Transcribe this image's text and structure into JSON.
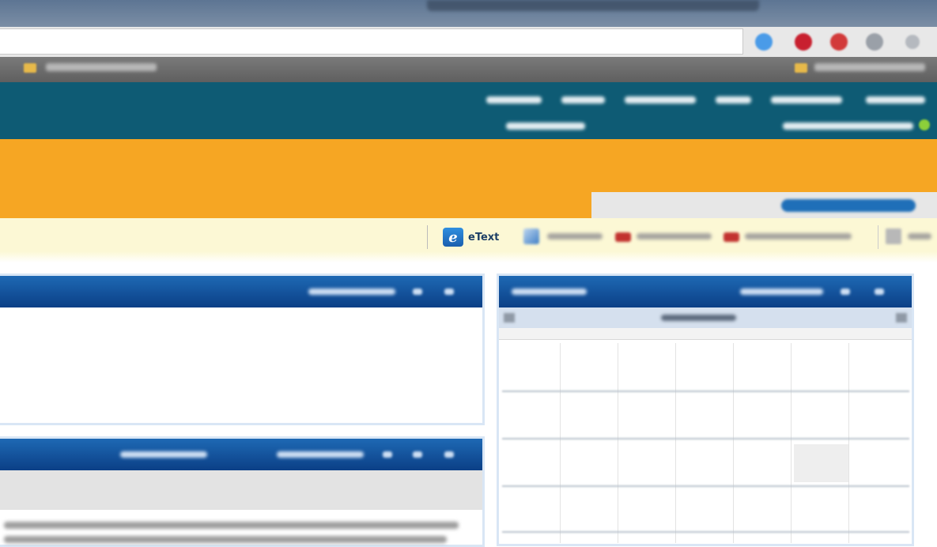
{
  "toolbar": {
    "etext_label": "eText",
    "etext_glyph": "e"
  },
  "icons": {
    "etext": "etext-icon",
    "pencil": "pencil-icon",
    "hat1": "graduation-cap-icon",
    "hat2": "graduation-cap-icon"
  },
  "colors": {
    "header_teal": "#0e5b74",
    "banner_orange": "#f6a623",
    "toolbar_yellow": "#fcf8d5",
    "panel_blue": "#0b3f86"
  }
}
